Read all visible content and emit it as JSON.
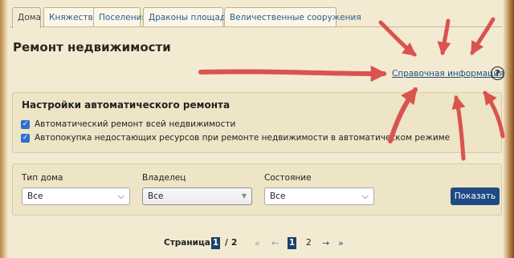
{
  "tabs": [
    {
      "label": "Дома",
      "active": true
    },
    {
      "label": "Княжества",
      "active": false
    },
    {
      "label": "Поселения",
      "active": false
    },
    {
      "label": "Драконы площадки",
      "active": false
    },
    {
      "label": "Величественные сооружения",
      "active": false
    }
  ],
  "page": {
    "title": "Ремонт недвижимости"
  },
  "help": {
    "link_text": "Справочная информация",
    "icon": "?"
  },
  "auto_repair": {
    "title": "Настройки автоматического ремонта",
    "options": [
      {
        "label": "Автоматический ремонт всей недвижимости",
        "checked": true
      },
      {
        "label": "Автопокупка недостающих ресурсов при ремонте недвижимости в автоматическом режиме",
        "checked": true
      }
    ]
  },
  "filters": {
    "type_label": "Тип дома",
    "type_value": "Все",
    "owner_label": "Владелец",
    "owner_value": "Все",
    "state_label": "Состояние",
    "state_value": "Все",
    "show_button": "Показать"
  },
  "pagination": {
    "label": "Страница:",
    "current": "1",
    "separator": "/",
    "total": "2",
    "pages": [
      "1",
      "2"
    ],
    "arrows": {
      "first": "«",
      "prev": "←",
      "next": "→",
      "last": "»"
    }
  },
  "colors": {
    "accent": "#1e4a86",
    "annotation": "#d9534f",
    "background": "#f3ead2"
  }
}
